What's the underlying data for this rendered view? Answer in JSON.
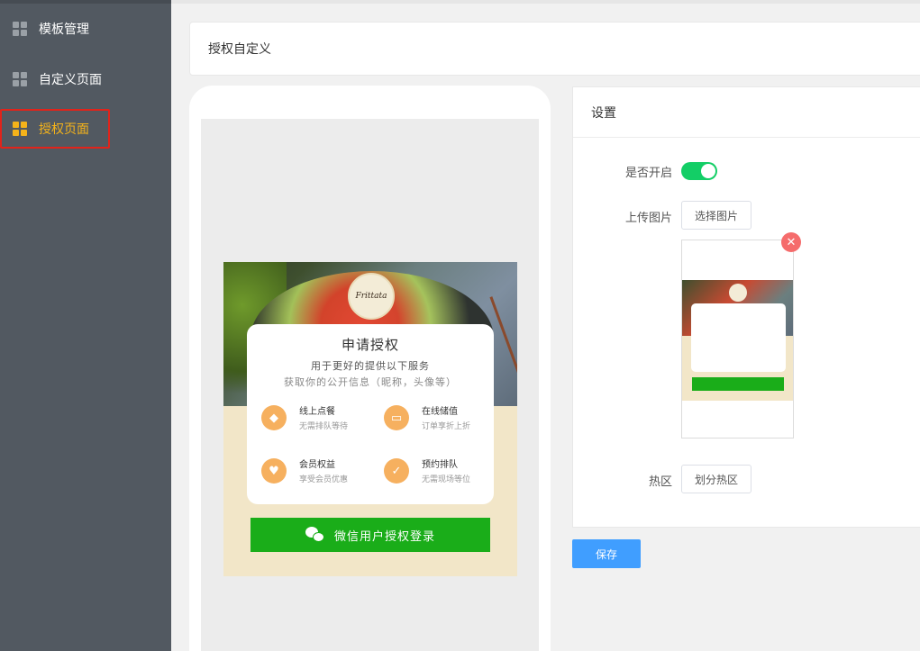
{
  "sidebar": {
    "items": [
      {
        "label": "模板管理",
        "icon": "grid-icon"
      },
      {
        "label": "自定义页面",
        "icon": "grid-icon"
      },
      {
        "label": "授权页面",
        "icon": "grid-icon",
        "active": true
      }
    ],
    "active_color": "#f5b31a"
  },
  "page": {
    "title": "授权自定义"
  },
  "preview": {
    "logo_text": "Frittata",
    "card": {
      "title": "申请授权",
      "subtitle": "用于更好的提供以下服务",
      "desc": "获取你的公开信息（昵称，头像等）",
      "features": [
        {
          "title": "线上点餐",
          "desc": "无需排队等待",
          "icon": "dish-icon"
        },
        {
          "title": "在线储值",
          "desc": "订单享折上折",
          "icon": "card-icon"
        },
        {
          "title": "会员权益",
          "desc": "享受会员优惠",
          "icon": "heart-icon"
        },
        {
          "title": "预约排队",
          "desc": "无需现场等位",
          "icon": "calendar-icon"
        }
      ]
    },
    "wechat_button": "微信用户授权登录"
  },
  "settings": {
    "header": "设置",
    "enable_label": "是否开启",
    "enabled": true,
    "upload_label": "上传图片",
    "choose_image_button": "选择图片",
    "hotzone_label": "热区",
    "divide_hotzone_button": "划分热区",
    "remove_icon": "close-icon"
  },
  "save_button": "保存"
}
